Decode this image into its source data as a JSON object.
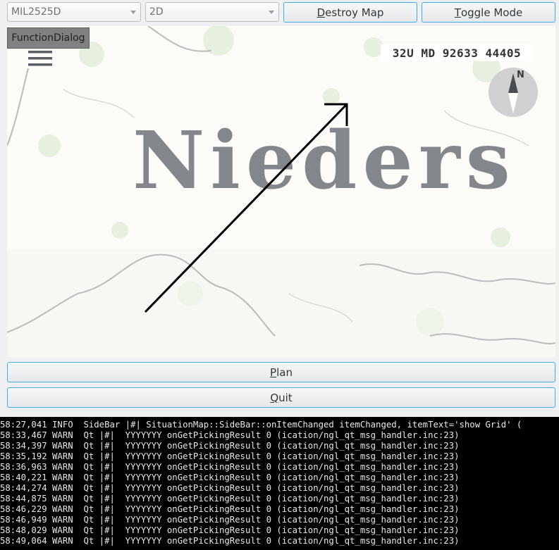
{
  "toolbar": {
    "symbology_select": "MIL2525D",
    "view_mode_select": "2D",
    "destroy_map": {
      "mnemonic": "D",
      "rest": "estroy Map"
    },
    "toggle_mode": {
      "mnemonic": "T",
      "rest": "oggle Mode"
    }
  },
  "map": {
    "function_dialog_label": "FunctionDialog",
    "coordinates": "32U MD 92633 44405",
    "compass_north_label": "N",
    "region_label": "Nieders",
    "icons": {
      "menu": "hamburger-menu-icon",
      "compass": "compass-icon"
    }
  },
  "actions": {
    "plan": {
      "mnemonic": "P",
      "rest": "lan"
    },
    "quit": {
      "mnemonic": "Q",
      "rest": "uit"
    }
  },
  "console": {
    "lines": [
      "58:27,041 INFO  SideBar |#| SituationMap::SideBar::onItemChanged itemChanged, itemText='show Grid' (",
      "58:33,467 WARN  Qt |#|  YYYYYYY onGetPickingResult 0 (ication/ngl_qt_msg_handler.inc:23)",
      "58:34,397 WARN  Qt |#|  YYYYYYY onGetPickingResult 0 (ication/ngl_qt_msg_handler.inc:23)",
      "58:35,192 WARN  Qt |#|  YYYYYYY onGetPickingResult 0 (ication/ngl_qt_msg_handler.inc:23)",
      "58:36,963 WARN  Qt |#|  YYYYYYY onGetPickingResult 0 (ication/ngl_qt_msg_handler.inc:23)",
      "58:40,221 WARN  Qt |#|  YYYYYYY onGetPickingResult 0 (ication/ngl_qt_msg_handler.inc:23)",
      "58:44,274 WARN  Qt |#|  YYYYYYY onGetPickingResult 0 (ication/ngl_qt_msg_handler.inc:23)",
      "58:44,875 WARN  Qt |#|  YYYYYYY onGetPickingResult 0 (ication/ngl_qt_msg_handler.inc:23)",
      "58:46,229 WARN  Qt |#|  YYYYYYY onGetPickingResult 0 (ication/ngl_qt_msg_handler.inc:23)",
      "58:46,949 WARN  Qt |#|  YYYYYYY onGetPickingResult 0 (ication/ngl_qt_msg_handler.inc:23)",
      "58:48,029 WARN  Qt |#|  YYYYYYY onGetPickingResult 0 (ication/ngl_qt_msg_handler.inc:23)",
      "58:49,064 WARN  Qt |#|  YYYYYYY onGetPickingResult 0 (ication/ngl_qt_msg_handler.inc:23)"
    ]
  },
  "colors": {
    "focus_border": "#3daee9",
    "console_bg": "#000000",
    "window_bg": "#eff0f1"
  }
}
